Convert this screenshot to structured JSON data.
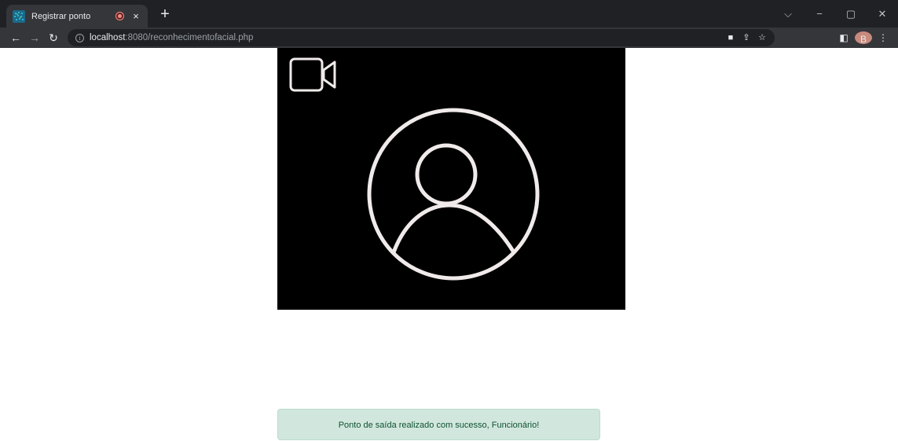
{
  "browser": {
    "tab_title": "Registrar ponto",
    "tab_close": "×",
    "new_tab": "+",
    "url_host": "localhost",
    "url_rest": ":8080/reconhecimentofacial.php",
    "profile_initial": "B",
    "accent_color": "#35363a"
  },
  "icons": {
    "back": "arrow-left-icon",
    "forward": "arrow-right-icon",
    "reload": "reload-icon",
    "info": "info-icon",
    "camera_indicator": "camera-icon",
    "share": "share-icon",
    "bookmark": "star-icon",
    "side_panel": "side-panel-icon",
    "menu": "kebab-menu-icon",
    "video_placeholder": "video-camera-icon",
    "user_placeholder": "user-circle-icon"
  },
  "page": {
    "alert_message": "Ponto de saída realizado com sucesso, Funcionário!",
    "alert_color": "#d1e7dd"
  }
}
